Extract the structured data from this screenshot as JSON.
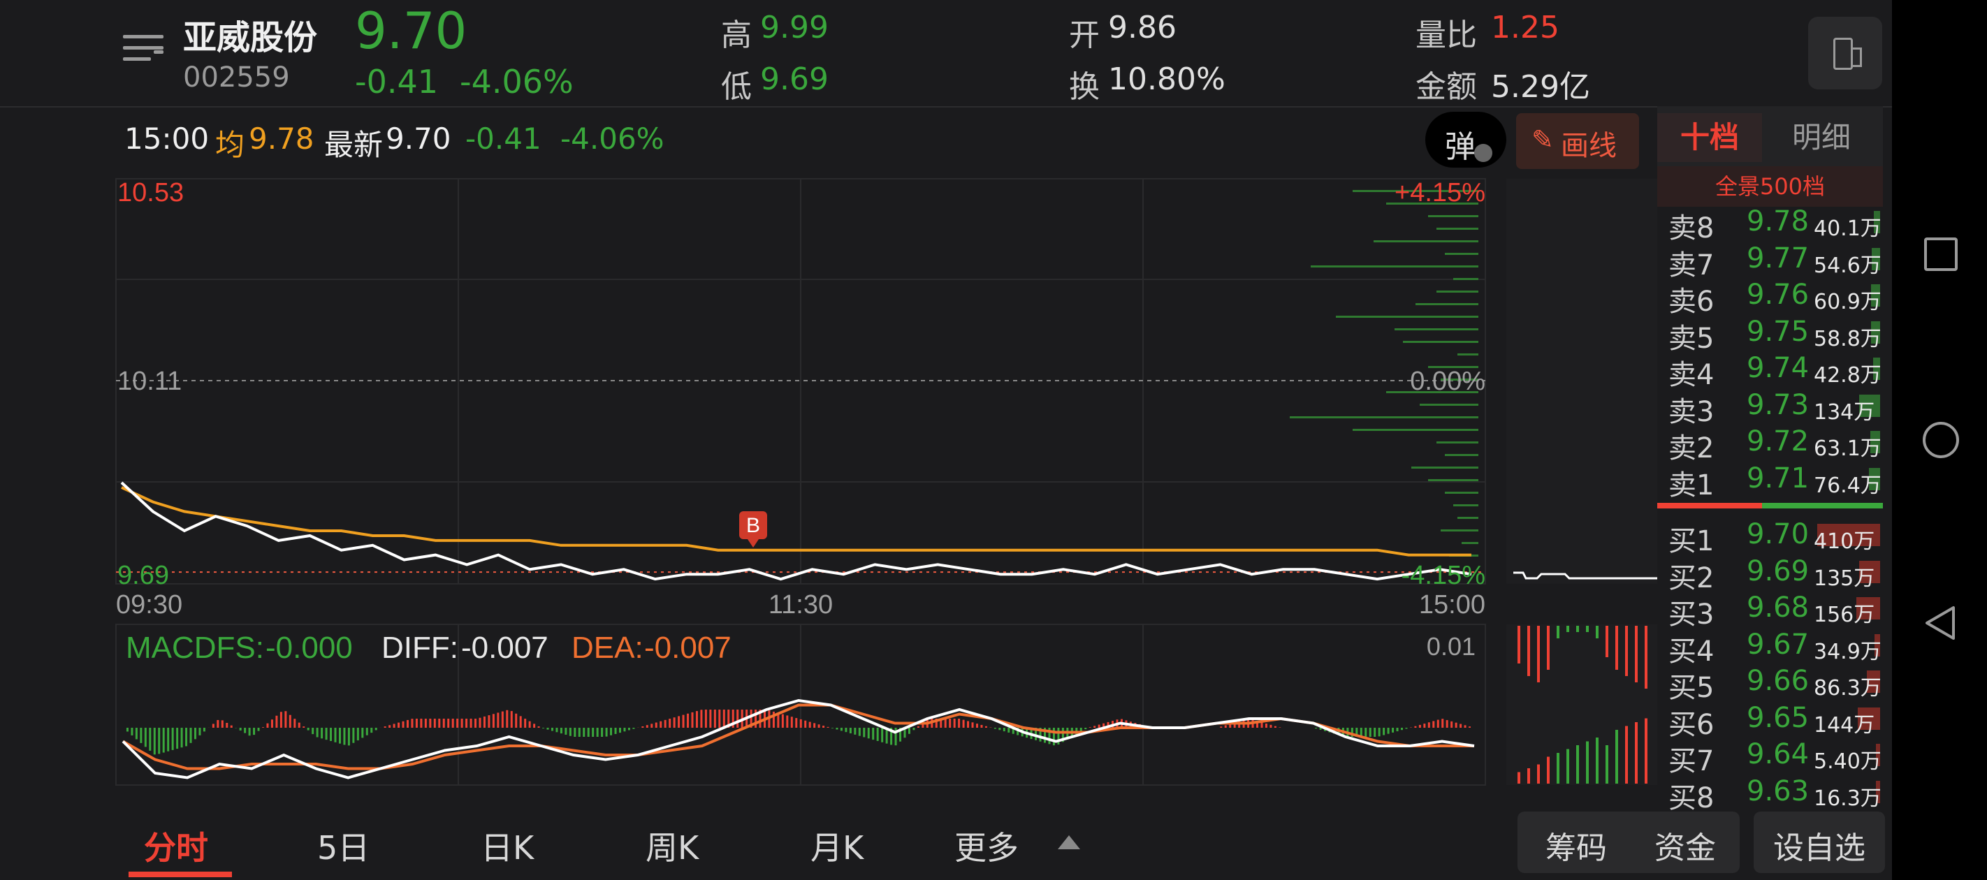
{
  "stock": {
    "name": "亚威股份",
    "code": "002559",
    "price": "9.70",
    "change": "-0.41",
    "change_pct": "-4.06%"
  },
  "stats": {
    "high_label": "高",
    "high": "9.99",
    "low_label": "低",
    "low": "9.69",
    "open_label": "开",
    "open": "9.86",
    "turnover_label": "换",
    "turnover": "10.80%",
    "volume_ratio_label": "量比",
    "volume_ratio": "1.25",
    "amount_label": "金额",
    "amount": "5.29亿"
  },
  "chart_bar": {
    "time": "15:00",
    "avg_label": "均",
    "avg": "9.78",
    "latest_label": "最新",
    "latest": "9.70",
    "change": "-0.41",
    "change_pct": "-4.06%",
    "bullet_label": "弹",
    "draw_label": "画线"
  },
  "chart_data": [
    {
      "type": "line",
      "title": "",
      "price_axis": {
        "top": "10.53",
        "mid": "10.11",
        "bottom": "9.69"
      },
      "pct_axis": {
        "top": "+4.15%",
        "mid": "0.00%",
        "bottom": "-4.15%"
      },
      "x_ticks": [
        "09:30",
        "11:30",
        "15:00"
      ],
      "ylim": [
        9.69,
        10.53
      ],
      "prev_close": 10.11,
      "marker": {
        "label": "B",
        "price": 9.7
      },
      "series": [
        {
          "values": [
            9.9,
            9.84,
            9.8,
            9.83,
            9.81,
            9.78,
            9.79,
            9.76,
            9.77,
            9.74,
            9.75,
            9.73,
            9.75,
            9.72,
            9.73,
            9.71,
            9.72,
            9.7,
            9.71,
            9.71,
            9.72,
            9.7,
            9.72,
            9.71,
            9.73,
            9.72,
            9.73,
            9.72,
            9.71,
            9.71,
            9.72,
            9.71,
            9.73,
            9.71,
            9.72,
            9.73,
            9.71,
            9.72,
            9.72,
            9.71,
            9.7,
            9.71,
            9.72,
            9.71
          ],
          "color": "#ffffff"
        },
        {
          "values": [
            9.89,
            9.86,
            9.84,
            9.83,
            9.82,
            9.81,
            9.8,
            9.8,
            9.79,
            9.79,
            9.78,
            9.78,
            9.78,
            9.78,
            9.77,
            9.77,
            9.77,
            9.77,
            9.77,
            9.76,
            9.76,
            9.76,
            9.76,
            9.76,
            9.76,
            9.76,
            9.76,
            9.76,
            9.76,
            9.76,
            9.76,
            9.76,
            9.76,
            9.76,
            9.76,
            9.76,
            9.76,
            9.76,
            9.76,
            9.76,
            9.76,
            9.75,
            9.75,
            9.75
          ],
          "color": "#f0a020"
        }
      ]
    },
    {
      "type": "line",
      "title": "",
      "indicator": {
        "macd_label": "MACDFS:",
        "macd": "-0.000",
        "diff_label": "DIFF:",
        "diff": "-0.007",
        "dea_label": "DEA:",
        "dea": "-0.007",
        "top_value": "0.01"
      },
      "ylim": [
        -0.012,
        0.012
      ],
      "series": [
        {
          "values": [
            -0.003,
            -0.01,
            -0.011,
            -0.008,
            -0.009,
            -0.006,
            -0.009,
            -0.011,
            -0.009,
            -0.007,
            -0.005,
            -0.004,
            -0.002,
            -0.004,
            -0.006,
            -0.007,
            -0.006,
            -0.004,
            -0.002,
            0.001,
            0.004,
            0.006,
            0.005,
            0.002,
            -0.001,
            0.002,
            0.004,
            0.002,
            -0.001,
            -0.003,
            -0.001,
            0.001,
            0.0,
            0.0,
            0.001,
            0.002,
            0.002,
            0.001,
            -0.002,
            -0.004,
            -0.004,
            -0.003,
            -0.004
          ],
          "color": "#ffffff"
        },
        {
          "values": [
            -0.003,
            -0.007,
            -0.009,
            -0.009,
            -0.008,
            -0.008,
            -0.008,
            -0.009,
            -0.009,
            -0.008,
            -0.006,
            -0.005,
            -0.004,
            -0.004,
            -0.005,
            -0.006,
            -0.006,
            -0.005,
            -0.004,
            -0.001,
            0.002,
            0.005,
            0.005,
            0.003,
            0.001,
            0.001,
            0.003,
            0.002,
            0.0,
            -0.001,
            -0.001,
            0.0,
            0.0,
            0.0,
            0.001,
            0.001,
            0.002,
            0.001,
            -0.001,
            -0.003,
            -0.004,
            -0.004,
            -0.004
          ],
          "color": "#f07030"
        }
      ]
    }
  ],
  "order_book": {
    "tab_active": "十档",
    "tab_other": "明细",
    "full_depth_label": "全景500档",
    "asks": [
      {
        "label": "卖8",
        "price": "9.78",
        "volume": "40.1万"
      },
      {
        "label": "卖7",
        "price": "9.77",
        "volume": "54.6万"
      },
      {
        "label": "卖6",
        "price": "9.76",
        "volume": "60.9万"
      },
      {
        "label": "卖5",
        "price": "9.75",
        "volume": "58.8万"
      },
      {
        "label": "卖4",
        "price": "9.74",
        "volume": "42.8万"
      },
      {
        "label": "卖3",
        "price": "9.73",
        "volume": "134万"
      },
      {
        "label": "卖2",
        "price": "9.72",
        "volume": "63.1万"
      },
      {
        "label": "卖1",
        "price": "9.71",
        "volume": "76.4万"
      }
    ],
    "bids": [
      {
        "label": "买1",
        "price": "9.70",
        "volume": "410万"
      },
      {
        "label": "买2",
        "price": "9.69",
        "volume": "135万"
      },
      {
        "label": "买3",
        "price": "9.68",
        "volume": "156万"
      },
      {
        "label": "买4",
        "price": "9.67",
        "volume": "34.9万"
      },
      {
        "label": "买5",
        "price": "9.66",
        "volume": "86.3万"
      },
      {
        "label": "买6",
        "price": "9.65",
        "volume": "144万"
      },
      {
        "label": "买7",
        "price": "9.64",
        "volume": "5.40万"
      },
      {
        "label": "买8",
        "price": "9.63",
        "volume": "16.3万"
      }
    ],
    "ask_fill": [
      0.08,
      0.11,
      0.12,
      0.12,
      0.09,
      0.27,
      0.13,
      0.15
    ],
    "bid_fill": [
      0.82,
      0.27,
      0.31,
      0.07,
      0.17,
      0.29,
      0.02,
      0.03
    ]
  },
  "tabs": [
    "分时",
    "5日",
    "日K",
    "周K",
    "月K",
    "更多"
  ],
  "bottom_buttons": {
    "chips": "筹码",
    "funds": "资金",
    "customize": "设自选"
  },
  "colors": {
    "up": "#f04134",
    "down": "#3aa83c",
    "avg": "#f0a020",
    "bg": "#1b1b1d"
  }
}
